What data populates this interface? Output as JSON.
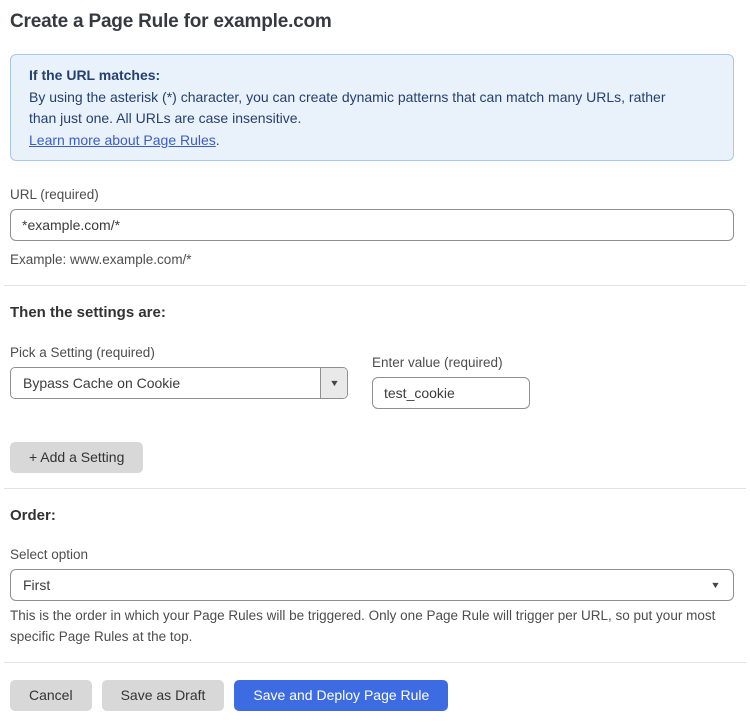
{
  "page_title": "Create a Page Rule for example.com",
  "notice": {
    "heading": "If the URL matches:",
    "body": "By using the asterisk (*) character, you can create dynamic patterns that can match many URLs, rather than just one. All URLs are case insensitive.",
    "link_label": "Learn more about Page Rules",
    "link_suffix": "."
  },
  "url_field": {
    "label": "URL (required)",
    "value": "*example.com/*",
    "helper": "Example: www.example.com/*"
  },
  "settings_section": {
    "heading": "Then the settings are:",
    "setting_select": {
      "label": "Pick a Setting (required)",
      "value": "Bypass Cache on Cookie"
    },
    "value_field": {
      "label": "Enter value (required)",
      "value": "test_cookie"
    },
    "add_setting_label": "+ Add a Setting"
  },
  "order_section": {
    "heading": "Order:",
    "select_label": "Select option",
    "selected_option": "First",
    "helper": "This is the order in which your Page Rules will be triggered. Only one Page Rule will trigger per URL, so put your most specific Page Rules at the top."
  },
  "footer": {
    "cancel_label": "Cancel",
    "save_draft_label": "Save as Draft",
    "save_deploy_label": "Save and Deploy Page Rule"
  },
  "icons": {
    "dropdown_arrow": "▼"
  },
  "colors": {
    "primary_blue": "#3d6ce2",
    "notice_bg": "#e9f1fb",
    "notice_border": "#a9c7ef",
    "notice_text": "#25406e",
    "link_blue": "#3b5dc9",
    "button_gray": "#d8d8d8"
  }
}
